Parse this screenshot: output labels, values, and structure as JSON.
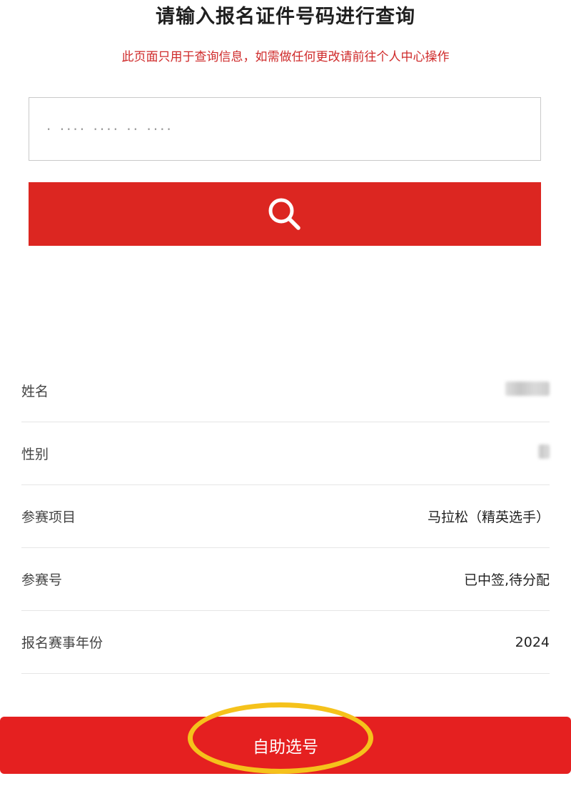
{
  "header": {
    "title": "请输入报名证件号码进行查询",
    "notice": "此页面只用于查询信息，如需做任何更改请前往个人中心操作"
  },
  "search": {
    "input_value": "· ···· ···· ·· ····",
    "button_icon": "search-icon"
  },
  "info": {
    "rows": [
      {
        "label": "姓名",
        "value": ""
      },
      {
        "label": "性别",
        "value": ""
      },
      {
        "label": "参赛项目",
        "value": "马拉松（精英选手）"
      },
      {
        "label": "参赛号",
        "value": "已中签,待分配"
      },
      {
        "label": "报名赛事年份",
        "value": "2024"
      }
    ]
  },
  "actions": {
    "select_number_label": "自助选号"
  },
  "colors": {
    "primary_red": "#dc2621",
    "notice_red": "#cf2a2a",
    "highlight_yellow": "#f5c21b"
  }
}
